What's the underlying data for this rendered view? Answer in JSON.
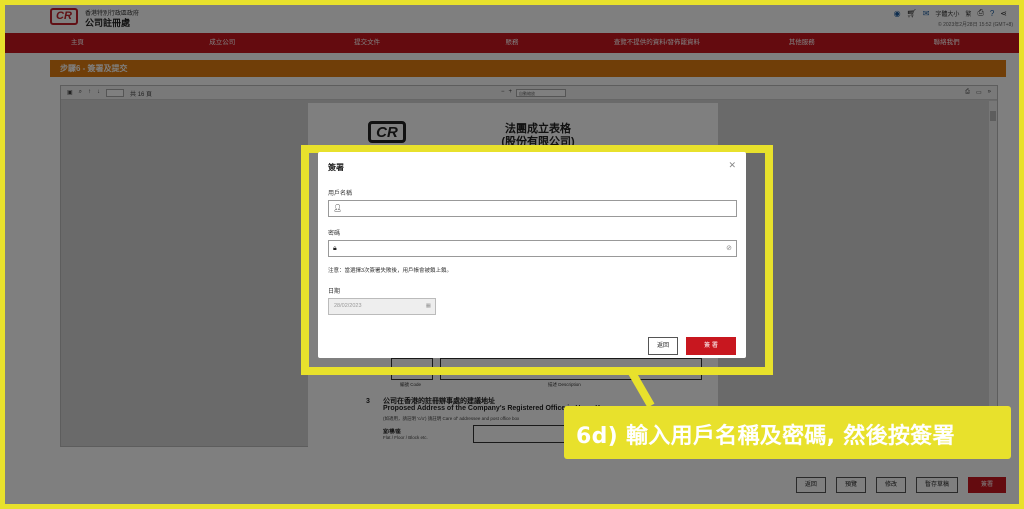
{
  "header": {
    "logo_text": "CR",
    "org_line1": "香港特別行政區政府",
    "org_line2": "公司註冊處",
    "font_size_label": "字體大小",
    "lang_label": "繁",
    "datetime": "© 2023年2月28日 15:52 (GMT+8)"
  },
  "nav": {
    "items": [
      "主頁",
      "成立公司",
      "提交文件",
      "賬務",
      "查覽不提供的資料/發佈罷資料",
      "其他服務",
      "聯絡我們"
    ]
  },
  "step_title": "步驟6 - 簽署及提交",
  "viewer": {
    "page_placeholder": "1",
    "page_count": "共 16 頁",
    "zoom_label": "自動縮放",
    "doc_logo": "CR",
    "doc_title_line1": "法團成立表格",
    "doc_title_line2": "(股份有限公司)",
    "code_label": "編號 Code",
    "desc_label": "描述 Description",
    "section_num": "3",
    "section_title_cn": "公司在香港的註冊辦事處的建議地址",
    "section_title_en": "Proposed Address of the Company's Registered Office in Hong Kong",
    "section_note": "(如適用，請註明 'c/o') 請註明 Care of' addressee and post office box",
    "flat_label": "室/樓/座",
    "flat_label_en": "Flat / Floor / Block etc."
  },
  "dialog": {
    "title": "簽署",
    "close_icon": "✕",
    "username_label": "用戶名稱",
    "username_value": "",
    "password_label": "密碼",
    "password_value": "",
    "note": "注意：當選擇3次簽署失敗後，用戶帳會被鎖上鎖。",
    "date_label": "日期",
    "date_value": "28/02/2023",
    "back_button": "返回",
    "sign_button": "簽 署"
  },
  "bottom_buttons": {
    "back": "返回",
    "preview": "預覽",
    "edit": "修改",
    "save_draft": "暫存草稿",
    "submit": "簽署"
  },
  "callout": {
    "text": "6d) 輸入用戶名稱及密碼, 然後按簽署"
  },
  "colors": {
    "brand_red": "#c8171f",
    "step_orange": "#e07d10",
    "highlight_yellow": "#e8e12c"
  }
}
